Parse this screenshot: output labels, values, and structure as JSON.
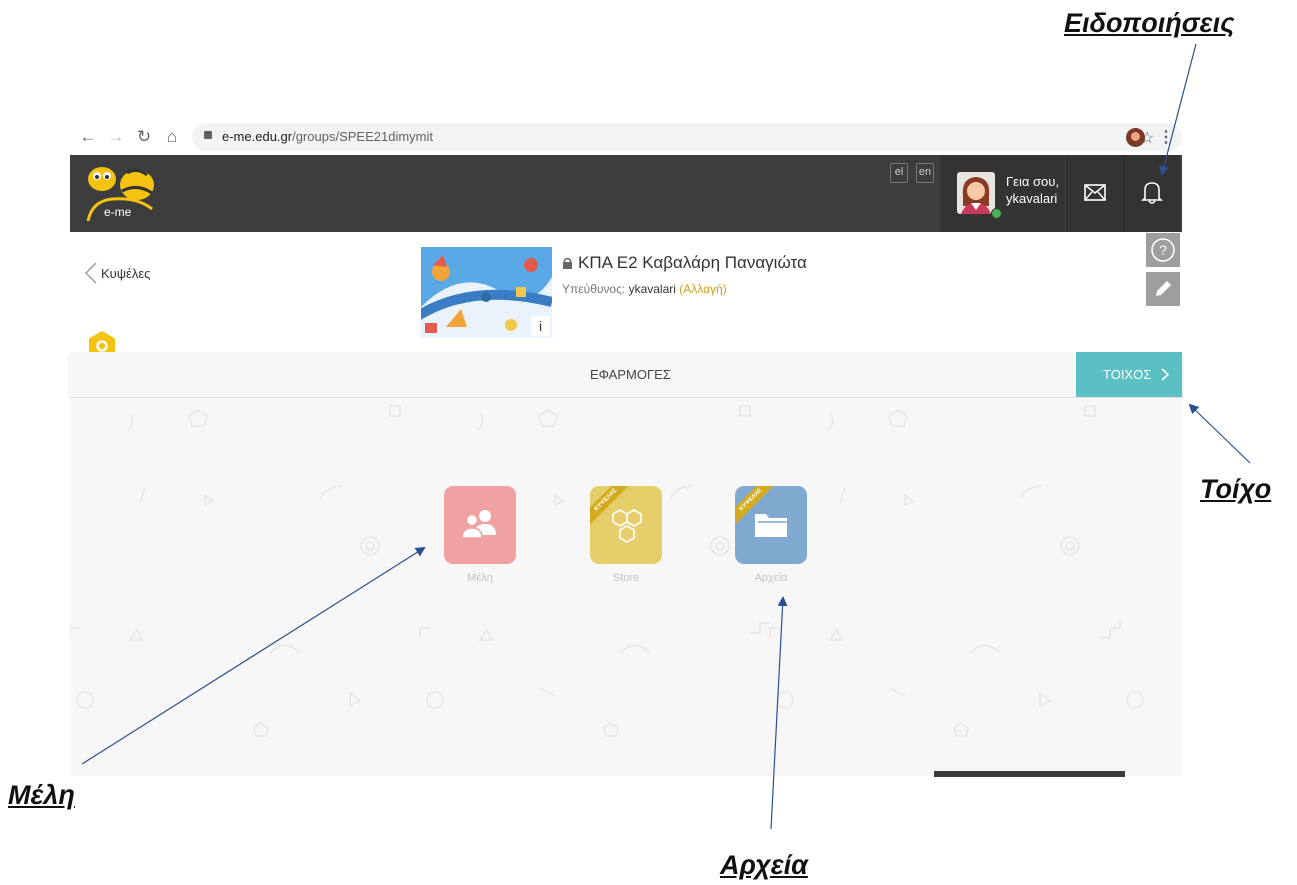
{
  "annotations": {
    "notifications": "Ειδοποιήσεις",
    "wall": "Τοίχο",
    "members": "Μέλη",
    "files": "Αρχεία"
  },
  "browser": {
    "url_domain": "e-me.edu.gr",
    "url_path": "/groups/SPEE21dimymit",
    "back_icon": "arrow-left-icon",
    "forward_icon": "arrow-right-icon",
    "reload_icon": "reload-icon",
    "home_icon": "home-icon",
    "star_icon": "star-icon",
    "menu_icon": "more-vert-icon"
  },
  "header": {
    "logo_text": "e-me",
    "lang_el": "el",
    "lang_en": "en",
    "greeting": "Γεια σου,",
    "username": "ykavalari",
    "mail_icon": "envelope-icon",
    "bell_icon": "bell-icon"
  },
  "group": {
    "back_label": "Κυψέλες",
    "title": "ΚΠΑ Ε2 Καβαλάρη Παναγιώτα",
    "owner_prefix": "Υπεύθυνος:",
    "owner": "ykavalari",
    "change_link": "(Αλλαγή)",
    "info_badge": "i"
  },
  "tabs": {
    "apps": "ΕΦΑΡΜΟΓΕΣ",
    "wall": "ΤΟΙΧΟΣ"
  },
  "apps": [
    {
      "label": "Μέλη",
      "color": "#f0a1a1",
      "icon": "users-icon"
    },
    {
      "label": "Store",
      "color": "#e6cf6b",
      "icon": "honeycomb-icon",
      "ribbon": "ΚΥΨΕΛΗΣ"
    },
    {
      "label": "Αρχεία",
      "color": "#7fa9cf",
      "icon": "folder-icon",
      "ribbon": "ΚΥΨΕΛΗΣ"
    }
  ],
  "colors": {
    "header_bg": "#3d3d3d",
    "accent_teal": "#5bc0c4",
    "accent_gold": "#d4a017",
    "annotation_arrow": "#2c4f8f"
  }
}
